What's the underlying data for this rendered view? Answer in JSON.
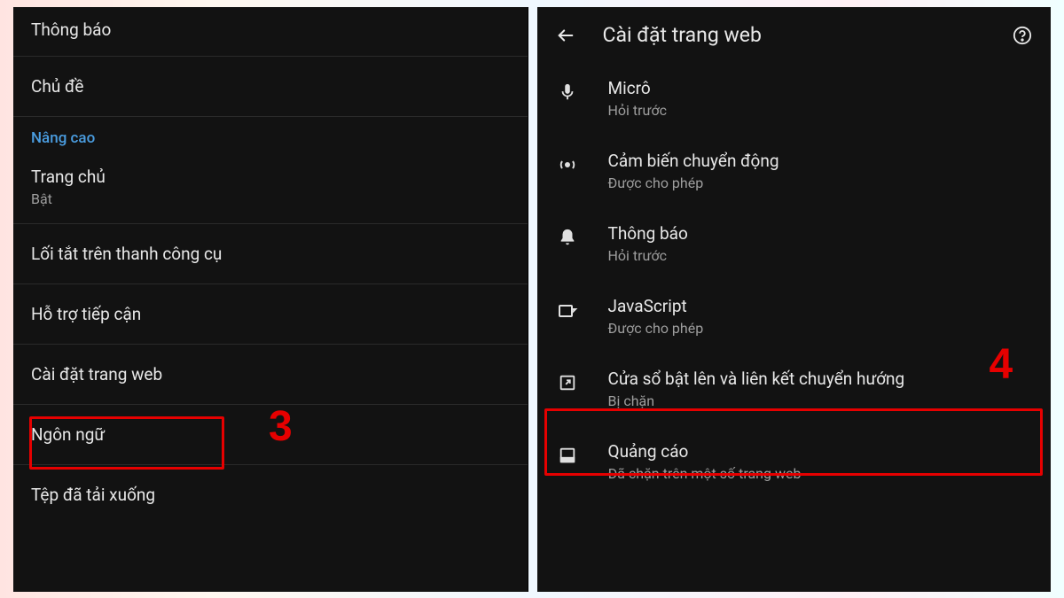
{
  "left": {
    "rows": [
      {
        "title": "Thông báo"
      },
      {
        "title": "Chủ đề"
      }
    ],
    "section_label": "Nâng cao",
    "home": {
      "title": "Trang chủ",
      "sub": "Bật"
    },
    "tail": [
      {
        "title": "Lối tắt trên thanh công cụ"
      },
      {
        "title": "Hỗ trợ tiếp cận"
      },
      {
        "title": "Cài đặt trang web"
      },
      {
        "title": "Ngôn ngữ"
      },
      {
        "title": "Tệp đã tải xuống"
      }
    ]
  },
  "right": {
    "header_title": "Cài đặt trang web",
    "items": [
      {
        "icon": "mic-icon",
        "title": "Micrô",
        "sub": "Hỏi trước"
      },
      {
        "icon": "motion-sensor-icon",
        "title": "Cảm biến chuyển động",
        "sub": "Được cho phép"
      },
      {
        "icon": "bell-icon",
        "title": "Thông báo",
        "sub": "Hỏi trước"
      },
      {
        "icon": "javascript-icon",
        "title": "JavaScript",
        "sub": "Được cho phép"
      },
      {
        "icon": "popup-icon",
        "title": "Cửa sổ bật lên và liên kết chuyển hướng",
        "sub": "Bị chặn"
      },
      {
        "icon": "ads-icon",
        "title": "Quảng cáo",
        "sub": "Đã chặn trên một số trang web"
      }
    ]
  },
  "annotations": {
    "step3": "3",
    "step4": "4"
  }
}
